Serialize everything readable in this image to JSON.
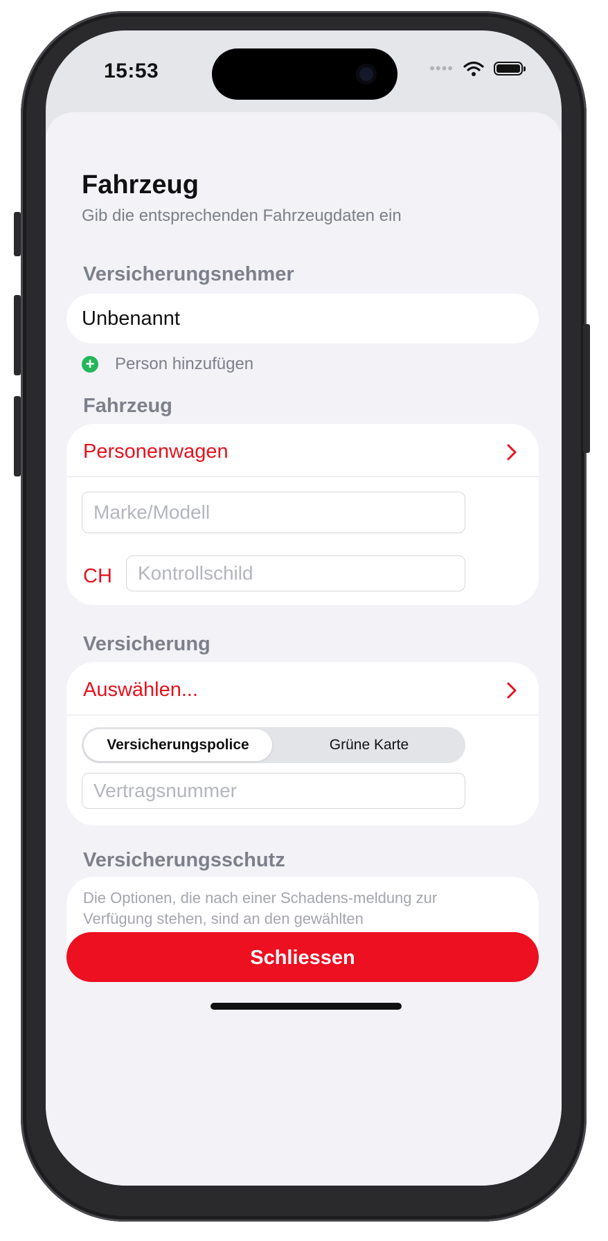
{
  "status_bar": {
    "time": "15:53",
    "signal_dots": "••••"
  },
  "page": {
    "title": "Fahrzeug",
    "subtitle": "Gib die entsprechenden Fahrzeugdaten ein"
  },
  "policyholder": {
    "header": "Versicherungsnehmer",
    "name": "Unbenannt",
    "add_person_label": "Person hinzufügen"
  },
  "vehicle": {
    "header": "Fahrzeug",
    "type_label": "Personenwagen",
    "make_model_placeholder": "Marke/Modell",
    "country_code": "CH",
    "plate_placeholder": "Kontrollschild"
  },
  "insurance": {
    "header": "Versicherung",
    "select_label": "Auswählen...",
    "tabs": [
      {
        "label": "Versicherungspolice",
        "active": true
      },
      {
        "label": "Grüne Karte",
        "active": false
      }
    ],
    "contract_placeholder": "Vertragsnummer"
  },
  "coverage": {
    "header": "Versicherungsschutz",
    "info_text": "Die Optionen, die nach einer Schadens-meldung zur Verfügung stehen, sind an den gewählten Versicherungsschutz gebunden."
  },
  "actions": {
    "close_label": "Schliessen"
  },
  "colors": {
    "accent": "#e5121e",
    "button": "#ec1021",
    "add_icon": "#24b65a",
    "section_header": "#7d808b",
    "background": "#f2f2f7"
  },
  "icons": [
    "wifi-icon",
    "battery-icon",
    "plus-circle-icon",
    "chevron-right-icon"
  ]
}
